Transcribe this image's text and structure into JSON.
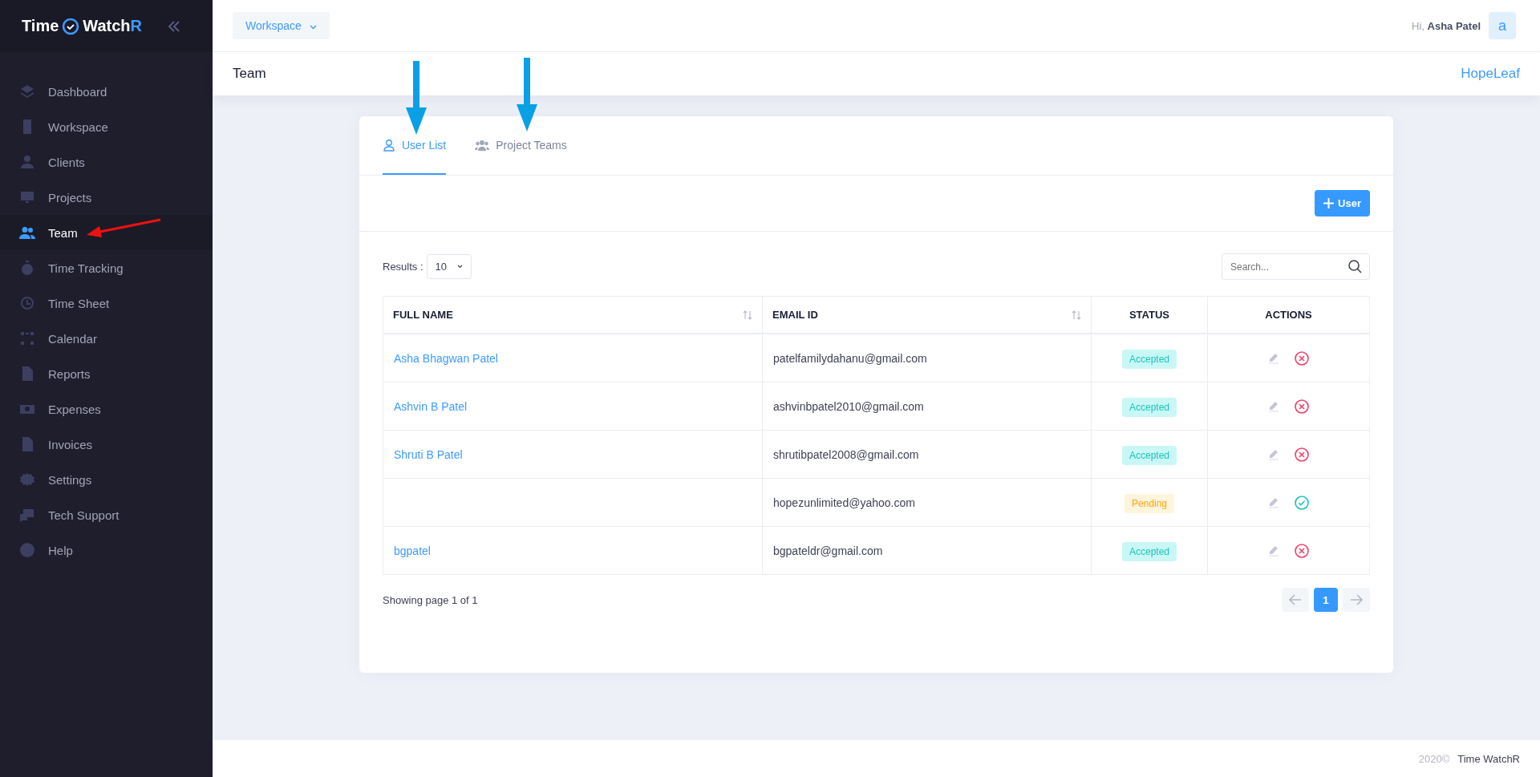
{
  "logo": {
    "word1": "Time",
    "word2": "Watch",
    "accent": "R"
  },
  "sidebar": {
    "items": [
      {
        "label": "Dashboard",
        "selected": false
      },
      {
        "label": "Workspace",
        "selected": false
      },
      {
        "label": "Clients",
        "selected": false
      },
      {
        "label": "Projects",
        "selected": false
      },
      {
        "label": "Team",
        "selected": true
      },
      {
        "label": "Time Tracking",
        "selected": false
      },
      {
        "label": "Time Sheet",
        "selected": false
      },
      {
        "label": "Calendar",
        "selected": false
      },
      {
        "label": "Reports",
        "selected": false
      },
      {
        "label": "Expenses",
        "selected": false
      },
      {
        "label": "Invoices",
        "selected": false
      },
      {
        "label": "Settings",
        "selected": false
      },
      {
        "label": "Tech Support",
        "selected": false
      },
      {
        "label": "Help",
        "selected": false
      }
    ]
  },
  "topbar": {
    "workspace_button": "Workspace",
    "greeting": "Hi,",
    "user_name": "Asha Patel",
    "avatar_letter": "a"
  },
  "subheader": {
    "title": "Team",
    "org": "HopeLeaf"
  },
  "tabs": [
    {
      "label": "User List",
      "selected": true
    },
    {
      "label": "Project Teams",
      "selected": false
    }
  ],
  "add_button": "User",
  "results": {
    "label": "Results :",
    "value": "10"
  },
  "search": {
    "placeholder": "Search..."
  },
  "table": {
    "columns": [
      "FULL NAME",
      "EMAIL ID",
      "STATUS",
      "ACTIONS"
    ],
    "rows": [
      {
        "name": "Asha Bhagwan Patel",
        "email": "patelfamilydahanu@gmail.com",
        "status": "Accepted",
        "kind": "accepted"
      },
      {
        "name": "Ashvin B Patel",
        "email": "ashvinbpatel2010@gmail.com",
        "status": "Accepted",
        "kind": "accepted"
      },
      {
        "name": "Shruti B Patel",
        "email": "shrutibpatel2008@gmail.com",
        "status": "Accepted",
        "kind": "accepted"
      },
      {
        "name": "",
        "email": "hopezunlimited@yahoo.com",
        "status": "Pending",
        "kind": "pending"
      },
      {
        "name": "bgpatel",
        "email": "bgpateldr@gmail.com",
        "status": "Accepted",
        "kind": "accepted"
      }
    ]
  },
  "pagination": {
    "summary": "Showing page 1 of 1",
    "pages": [
      {
        "label": "1",
        "selected": true
      }
    ]
  },
  "footer": {
    "year": "2020©",
    "brand": "Time WatchR"
  }
}
